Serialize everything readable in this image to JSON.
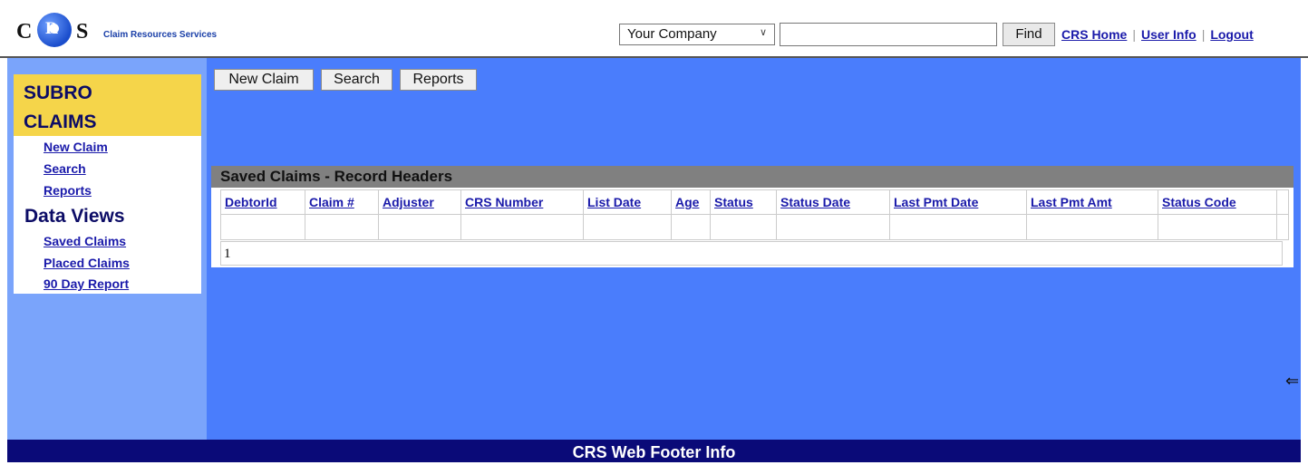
{
  "header": {
    "logo_c": "C",
    "logo_r": "R",
    "logo_s": "S",
    "brand_name": "Claim Resources Services",
    "company_select": "Your Company",
    "search_value": "",
    "find_label": "Find",
    "links": [
      "CRS Home",
      "User Info",
      "Logout"
    ]
  },
  "sidebar": {
    "subro_line1": "SUBRO",
    "subro_line2": "CLAIMS",
    "claim_links": [
      "New Claim",
      "Search",
      "Reports"
    ],
    "data_views_title": "Data Views",
    "view_links": [
      "Saved Claims",
      "Placed Claims",
      "90 Day Report"
    ]
  },
  "toolbar": {
    "buttons": [
      "New Claim",
      "Search",
      "Reports"
    ]
  },
  "saved_claims": {
    "title": "Saved Claims - Record Headers",
    "columns": [
      "DebtorId",
      "Claim #",
      "Adjuster",
      "CRS Number",
      "List Date",
      "Age",
      "Status",
      "Status Date",
      "Last Pmt Date",
      "Last Pmt Amt",
      "Status Code",
      ""
    ],
    "pager": "1"
  },
  "footer": {
    "text": "CRS Web Footer Info"
  },
  "colors": {
    "main_bg": "#4a7dfc",
    "sidebar_bg": "#7aa4fb",
    "title_yellow": "#f5d54a",
    "footer_bg": "#0a0a78",
    "link": "#1a1aaa"
  }
}
